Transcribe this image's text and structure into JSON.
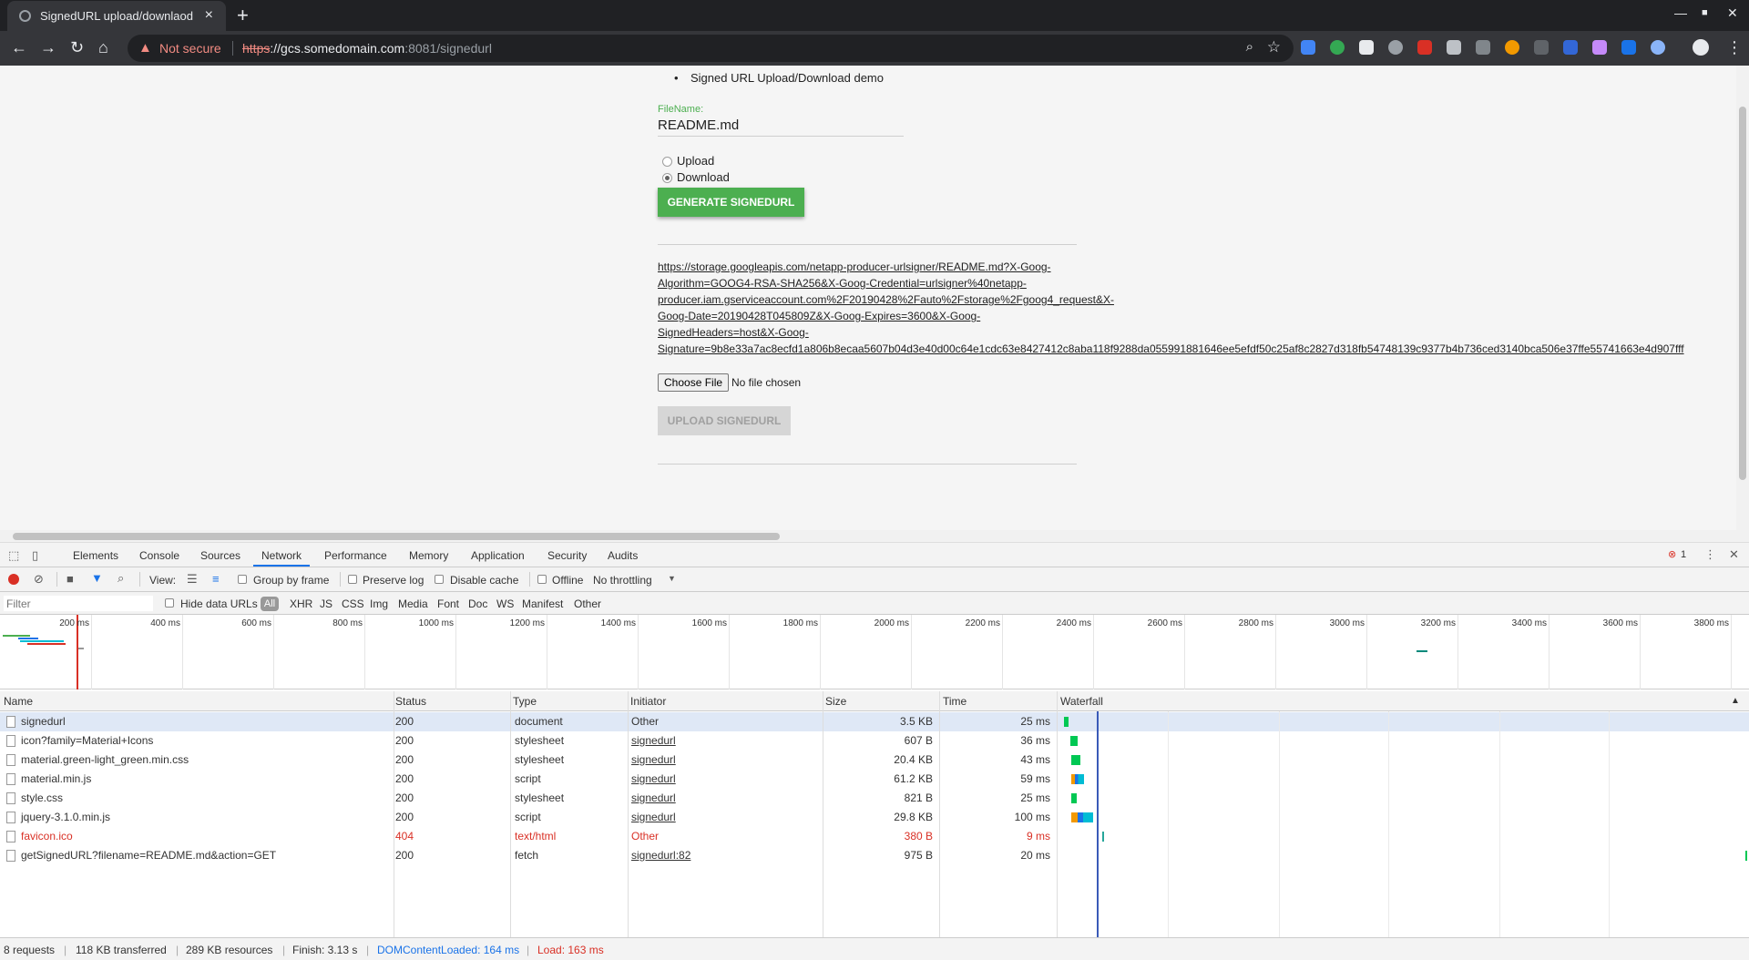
{
  "browser": {
    "tab_title": "SignedURL upload/downlaod",
    "security_label": "Not secure",
    "url_scheme": "https",
    "url_host": "://gcs.somedomain.com",
    "url_rest": ":8081/signedurl"
  },
  "page": {
    "bullet_text": "Signed URL Upload/Download demo",
    "filename_label": "FileName:",
    "filename_value": "README.md",
    "radio_upload": "Upload",
    "radio_download": "Download",
    "selected_radio": "Download",
    "generate_button": "GENERATE SIGNEDURL",
    "signed_url_lines": [
      "https://storage.googleapis.com/netapp-producer-urlsigner/README.md?X-Goog-",
      "Algorithm=GOOG4-RSA-SHA256&X-Goog-Credential=urlsigner%40netapp-",
      "producer.iam.gserviceaccount.com%2F20190428%2Fauto%2Fstorage%2Fgoog4_request&X-",
      "Goog-Date=20190428T045809Z&X-Goog-Expires=3600&X-Goog-",
      "SignedHeaders=host&X-Goog-",
      "Signature=9b8e33a7ac8ecfd1a806b8ecaa5607b04d3e40d00c64e1cdc63e8427412c8aba118f9288da055991881646ee5efdf50c25af8c2827d318fb54748139c9377b4b736ced3140bca506e37ffe55741663e4d907fff"
    ],
    "choose_file": "Choose File",
    "no_file": "No file chosen",
    "upload_button": "UPLOAD SIGNEDURL"
  },
  "devtools": {
    "tabs": [
      "Elements",
      "Console",
      "Sources",
      "Network",
      "Performance",
      "Memory",
      "Application",
      "Security",
      "Audits"
    ],
    "active_tab": "Network",
    "error_count": "1",
    "toolbar": {
      "view_label": "View:",
      "group_by_frame": "Group by frame",
      "preserve_log": "Preserve log",
      "disable_cache": "Disable cache",
      "offline": "Offline",
      "throttling": "No throttling"
    },
    "filter": {
      "placeholder": "Filter",
      "hide_data_urls": "Hide data URLs",
      "types": [
        "All",
        "XHR",
        "JS",
        "CSS",
        "Img",
        "Media",
        "Font",
        "Doc",
        "WS",
        "Manifest",
        "Other"
      ]
    },
    "overview_ticks": [
      "200 ms",
      "400 ms",
      "600 ms",
      "800 ms",
      "1000 ms",
      "1200 ms",
      "1400 ms",
      "1600 ms",
      "1800 ms",
      "2000 ms",
      "2200 ms",
      "2400 ms",
      "2600 ms",
      "2800 ms",
      "3000 ms",
      "3200 ms",
      "3400 ms",
      "3600 ms",
      "3800 ms"
    ],
    "columns": [
      "Name",
      "Status",
      "Type",
      "Initiator",
      "Size",
      "Time",
      "Waterfall"
    ],
    "rows": [
      {
        "name": "signedurl",
        "status": "200",
        "type": "document",
        "initiator": "Other",
        "size": "3.5 KB",
        "time": "25 ms",
        "wf_start": 4,
        "wf_len": 5,
        "error": false,
        "selected": true,
        "init_link": false
      },
      {
        "name": "icon?family=Material+Icons",
        "status": "200",
        "type": "stylesheet",
        "initiator": "signedurl",
        "size": "607 B",
        "time": "36 ms",
        "wf_start": 11,
        "wf_len": 8,
        "error": false,
        "selected": false,
        "init_link": true
      },
      {
        "name": "material.green-light_green.min.css",
        "status": "200",
        "type": "stylesheet",
        "initiator": "signedurl",
        "size": "20.4 KB",
        "time": "43 ms",
        "wf_start": 12,
        "wf_len": 10,
        "error": false,
        "selected": false,
        "init_link": true
      },
      {
        "name": "material.min.js",
        "status": "200",
        "type": "script",
        "initiator": "signedurl",
        "size": "61.2 KB",
        "time": "59 ms",
        "wf_start": 12,
        "wf_len": 14,
        "error": false,
        "selected": false,
        "init_link": true
      },
      {
        "name": "style.css",
        "status": "200",
        "type": "stylesheet",
        "initiator": "signedurl",
        "size": "821 B",
        "time": "25 ms",
        "wf_start": 12,
        "wf_len": 6,
        "error": false,
        "selected": false,
        "init_link": true
      },
      {
        "name": "jquery-3.1.0.min.js",
        "status": "200",
        "type": "script",
        "initiator": "signedurl",
        "size": "29.8 KB",
        "time": "100 ms",
        "wf_start": 12,
        "wf_len": 24,
        "error": false,
        "selected": false,
        "init_link": true
      },
      {
        "name": "favicon.ico",
        "status": "404",
        "type": "text/html",
        "initiator": "Other",
        "size": "380 B",
        "time": "9 ms",
        "wf_start": 46,
        "wf_len": 2,
        "error": true,
        "selected": false,
        "init_link": false
      },
      {
        "name": "getSignedURL?filename=README.md&action=GET",
        "status": "200",
        "type": "fetch",
        "initiator": "signedurl:82",
        "size": "975 B",
        "time": "20 ms",
        "wf_start": 752,
        "wf_len": 2,
        "error": false,
        "selected": false,
        "init_link": true
      }
    ],
    "status": {
      "requests": "8 requests",
      "transferred": "118 KB transferred",
      "resources": "289 KB resources",
      "finish": "Finish: 3.13 s",
      "domcontentloaded": "DOMContentLoaded: 164 ms",
      "load": "Load: 163 ms"
    }
  },
  "colors": {
    "accent_green": "#4caf50",
    "error_red": "#d93025",
    "dcl_blue": "#1a73e8"
  }
}
